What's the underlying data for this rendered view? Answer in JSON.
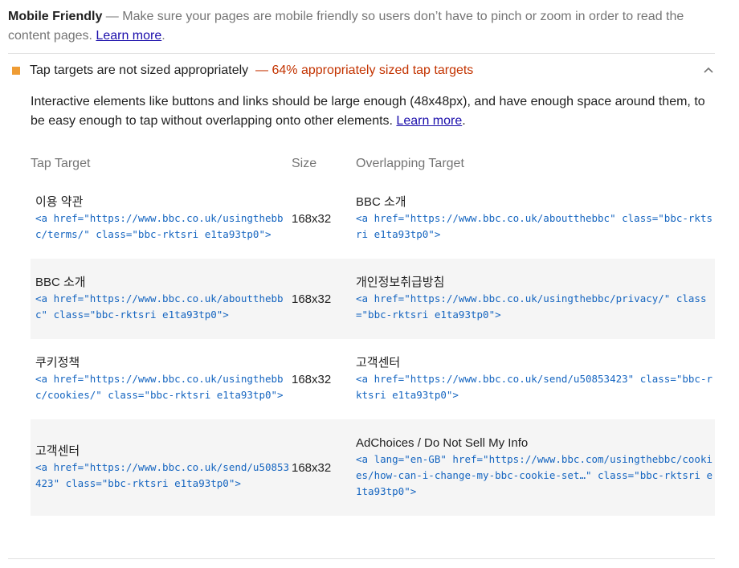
{
  "group": {
    "title": "Mobile Friendly",
    "description": " — Make sure your pages are mobile friendly so users don’t have to pinch or zoom in order to read the content pages. ",
    "learn_more": "Learn more",
    "trailing": "."
  },
  "audit": {
    "title": "Tap targets are not sized appropriately",
    "display_value": "— 64% appropriately sized tap targets",
    "description": "Interactive elements like buttons and links should be large enough (48x48px), and have enough space around them, to be easy enough to tap without overlapping onto other elements. ",
    "learn_more": "Learn more",
    "trailing": "."
  },
  "table": {
    "headers": [
      "Tap Target",
      "Size",
      "Overlapping Target"
    ],
    "rows": [
      {
        "target_label": "이용 약관",
        "target_snippet": "<a href=\"https://www.bbc.co.uk/usingthebbc/terms/\" class=\"bbc-rktsri e1ta93tp0\">",
        "size": "168x32",
        "overlap_label": "BBC 소개",
        "overlap_snippet": "<a href=\"https://www.bbc.co.uk/aboutthebbc\" class=\"bbc-rktsri e1ta93tp0\">"
      },
      {
        "target_label": "BBC 소개",
        "target_snippet": "<a href=\"https://www.bbc.co.uk/aboutthebbc\" class=\"bbc-rktsri e1ta93tp0\">",
        "size": "168x32",
        "overlap_label": "개인정보취급방침",
        "overlap_snippet": "<a href=\"https://www.bbc.co.uk/usingthebbc/privacy/\" class=\"bbc-rktsri e1ta93tp0\">"
      },
      {
        "target_label": "쿠키정책",
        "target_snippet": "<a href=\"https://www.bbc.co.uk/usingthebbc/cookies/\" class=\"bbc-rktsri e1ta93tp0\">",
        "size": "168x32",
        "overlap_label": "고객센터",
        "overlap_snippet": "<a href=\"https://www.bbc.co.uk/send/u50853423\" class=\"bbc-rktsri e1ta93tp0\">"
      },
      {
        "target_label": "고객센터",
        "target_snippet": "<a href=\"https://www.bbc.co.uk/send/u50853423\" class=\"bbc-rktsri e1ta93tp0\">",
        "size": "168x32",
        "overlap_label": "AdChoices / Do Not Sell My Info",
        "overlap_snippet": "<a lang=\"en-GB\" href=\"https://www.bbc.com/usingthebbc/cookies/how-can-i-change-my-bbc-cookie-set…\" class=\"bbc-rktsri e1ta93tp0\">"
      }
    ]
  },
  "icons": {
    "fail": "fail-square-icon",
    "chevron": "chevron-up-icon"
  },
  "colors": {
    "fail": "#ef9c34",
    "display_value": "#c33300",
    "snippet": "#1565c0",
    "link": "#1a0dab"
  }
}
